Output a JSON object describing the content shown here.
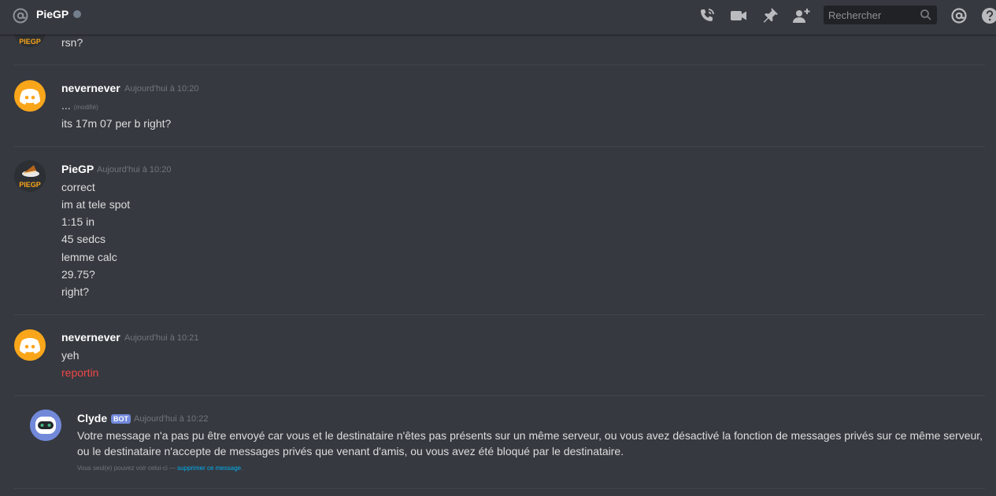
{
  "header": {
    "channel_name": "PieGP",
    "search_placeholder": "Rechercher",
    "icons": [
      "at-icon",
      "call-icon",
      "video-icon",
      "pin-icon",
      "add-friend-icon",
      "search-icon",
      "mention-icon",
      "help-icon"
    ]
  },
  "messages": {
    "m0": {
      "lines": [
        "rsn?"
      ]
    },
    "m1": {
      "author": "nevernever",
      "timestamp": "Aujourd'hui à 10:20",
      "line1": "...",
      "edited": "(modifié)",
      "line2": "its 17m 07 per b right?"
    },
    "m2": {
      "author": "PieGP",
      "timestamp": "Aujourd'hui à 10:20",
      "lines": [
        "correct",
        "im at tele spot",
        "1:15 in",
        "45 sedcs",
        "lemme calc",
        "29.75?",
        "right?"
      ]
    },
    "m3": {
      "author": "nevernever",
      "timestamp": "Aujourd'hui à 10:21",
      "lines": [
        "yeh",
        "reportin"
      ]
    },
    "m4": {
      "author": "Clyde",
      "bot_tag": "BOT",
      "timestamp": "Aujourd'hui à 10:22",
      "text_line1": "Votre message n'a pas pu être envoyé car vous et le destinataire n'êtes pas présents sur un même serveur, ou vous avez désactivé la fonction de messages privés sur ce même serveur,",
      "text_line2": "ou le destinataire n'accepte de messages privés que venant d'amis, ou vous avez été bloqué par le destinataire.",
      "only_you": "Vous seul(e) pouvez voir celui-ci — ",
      "delete_link": "supprimer ce message",
      "delete_suffix": "."
    }
  },
  "colors": {
    "background": "#36393f",
    "discord_orange": "#faa61a",
    "blurple": "#7289da",
    "red_text": "#f04747",
    "link": "#00b0f4"
  }
}
